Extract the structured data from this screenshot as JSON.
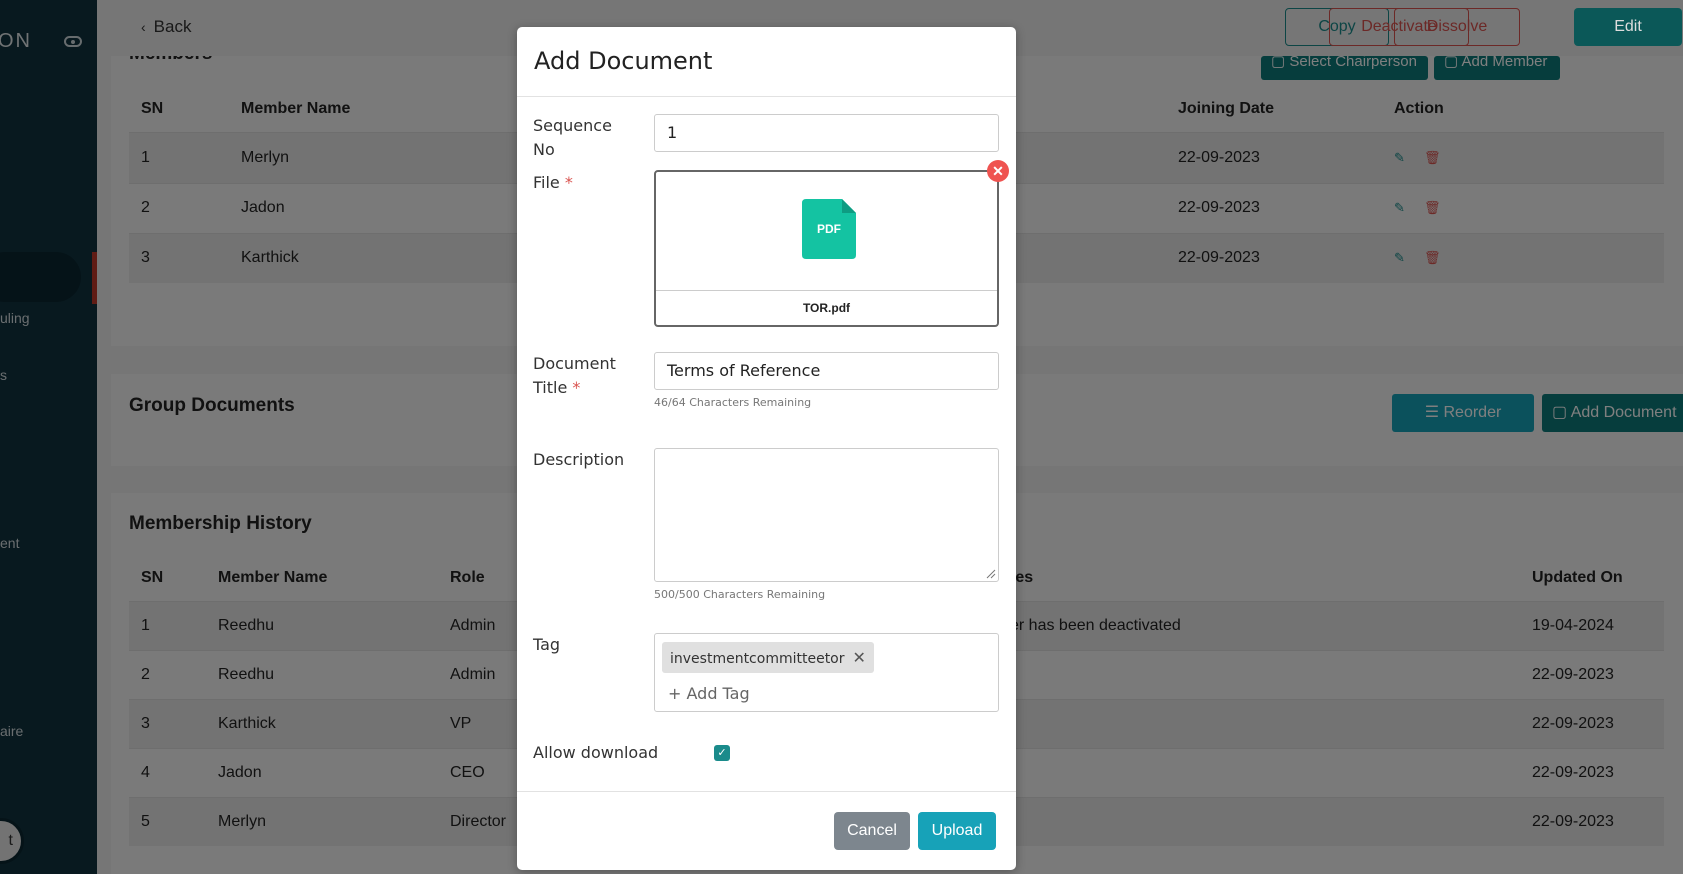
{
  "sidebar": {
    "brand": "ON",
    "items": [
      {
        "label": "uling",
        "top": 0
      },
      {
        "label": "s"
      },
      {
        "label": "ent"
      },
      {
        "label": "aire"
      }
    ],
    "avatar_text": "t"
  },
  "topbar": {
    "back_label": "Back",
    "copy_label": "Copy",
    "dissolve_label": "Dissolve",
    "deactivate_label": "Deactivate",
    "edit_label": "Edit"
  },
  "members": {
    "title": "Members",
    "select_chair_label": "Select Chairperson",
    "add_member_label": "Add Member",
    "headers": [
      "SN",
      "Member Name",
      "Joining Date",
      "Action"
    ],
    "rows": [
      {
        "sn": "1",
        "name": "Merlyn",
        "date": "22-09-2023"
      },
      {
        "sn": "2",
        "name": "Jadon",
        "date": "22-09-2023"
      },
      {
        "sn": "3",
        "name": "Karthick",
        "date": "22-09-2023"
      }
    ]
  },
  "group_documents": {
    "title": "Group Documents",
    "reorder_label": "Reorder",
    "add_document_label": "Add Document"
  },
  "history": {
    "title": "Membership History",
    "headers": [
      "SN",
      "Member Name",
      "Role",
      "tes",
      "Updated On"
    ],
    "rows": [
      {
        "sn": "1",
        "name": "Reedhu",
        "role": "Admin",
        "notes": "er has been deactivated",
        "updated": "19-04-2024"
      },
      {
        "sn": "2",
        "name": "Reedhu",
        "role": "Admin",
        "notes": "",
        "updated": "22-09-2023"
      },
      {
        "sn": "3",
        "name": "Karthick",
        "role": "VP",
        "notes": "",
        "updated": "22-09-2023"
      },
      {
        "sn": "4",
        "name": "Jadon",
        "role": "CEO",
        "notes": "",
        "updated": "22-09-2023"
      },
      {
        "sn": "5",
        "name": "Merlyn",
        "role": "Director",
        "notes": "",
        "updated": "22-09-2023"
      }
    ]
  },
  "modal": {
    "title": "Add Document",
    "sequence_label": "Sequence No",
    "sequence_value": "1",
    "file_label": "File",
    "file_name": "TOR.pdf",
    "pdf_badge": "PDF",
    "doc_title_label": "Document Title",
    "doc_title_value": "Terms of Reference",
    "doc_title_hint": "46/64 Characters Remaining",
    "description_label": "Description",
    "description_value": "",
    "description_hint": "500/500 Characters Remaining",
    "tag_label": "Tag",
    "tags": [
      "investmentcommitteetor"
    ],
    "add_tag_placeholder": "+ Add Tag",
    "allow_download_label": "Allow download",
    "allow_download_checked": true,
    "cancel_label": "Cancel",
    "upload_label": "Upload",
    "required_mark": "*"
  },
  "colors": {
    "teal": "#1a8b8b",
    "teal_dark": "#0d6e6e",
    "danger": "#d9534f",
    "upload": "#17a2b8",
    "pdf": "#14c3a2"
  }
}
